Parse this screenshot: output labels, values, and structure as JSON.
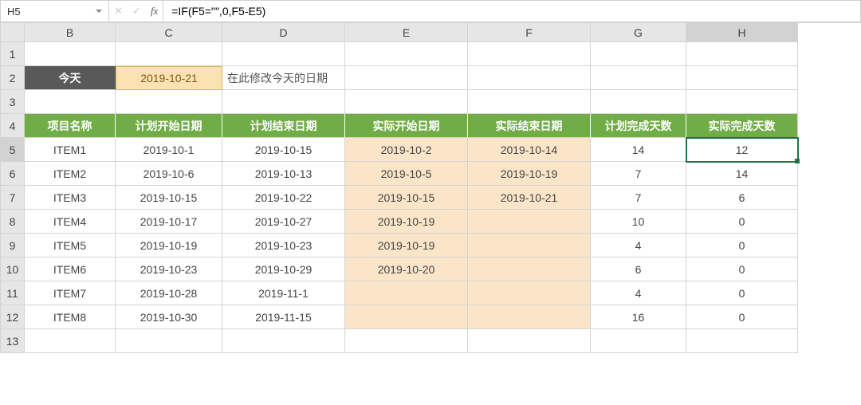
{
  "namebox": "H5",
  "formula": "=IF(F5=\"\",0,F5-E5)",
  "fx_label": "fx",
  "columns": [
    "B",
    "C",
    "D",
    "E",
    "F",
    "G",
    "H"
  ],
  "row_numbers": [
    "1",
    "2",
    "3",
    "4",
    "5",
    "6",
    "7",
    "8",
    "9",
    "10",
    "11",
    "12",
    "13"
  ],
  "today": {
    "label": "今天",
    "date": "2019-10-21",
    "note": "在此修改今天的日期"
  },
  "headers": {
    "B": "项目名称",
    "C": "计划开始日期",
    "D": "计划结束日期",
    "E": "实际开始日期",
    "F": "实际结束日期",
    "G": "计划完成天数",
    "H": "实际完成天数"
  },
  "rows": [
    {
      "B": "ITEM1",
      "C": "2019-10-1",
      "D": "2019-10-15",
      "E": "2019-10-2",
      "F": "2019-10-14",
      "G": "14",
      "H": "12"
    },
    {
      "B": "ITEM2",
      "C": "2019-10-6",
      "D": "2019-10-13",
      "E": "2019-10-5",
      "F": "2019-10-19",
      "G": "7",
      "H": "14"
    },
    {
      "B": "ITEM3",
      "C": "2019-10-15",
      "D": "2019-10-22",
      "E": "2019-10-15",
      "F": "2019-10-21",
      "G": "7",
      "H": "6"
    },
    {
      "B": "ITEM4",
      "C": "2019-10-17",
      "D": "2019-10-27",
      "E": "2019-10-19",
      "F": "",
      "G": "10",
      "H": "0"
    },
    {
      "B": "ITEM5",
      "C": "2019-10-19",
      "D": "2019-10-23",
      "E": "2019-10-19",
      "F": "",
      "G": "4",
      "H": "0"
    },
    {
      "B": "ITEM6",
      "C": "2019-10-23",
      "D": "2019-10-29",
      "E": "2019-10-20",
      "F": "",
      "G": "6",
      "H": "0"
    },
    {
      "B": "ITEM7",
      "C": "2019-10-28",
      "D": "2019-11-1",
      "E": "",
      "F": "",
      "G": "4",
      "H": "0"
    },
    {
      "B": "ITEM8",
      "C": "2019-10-30",
      "D": "2019-11-15",
      "E": "",
      "F": "",
      "G": "16",
      "H": "0"
    }
  ],
  "selected": {
    "row": 5,
    "col": "H"
  }
}
